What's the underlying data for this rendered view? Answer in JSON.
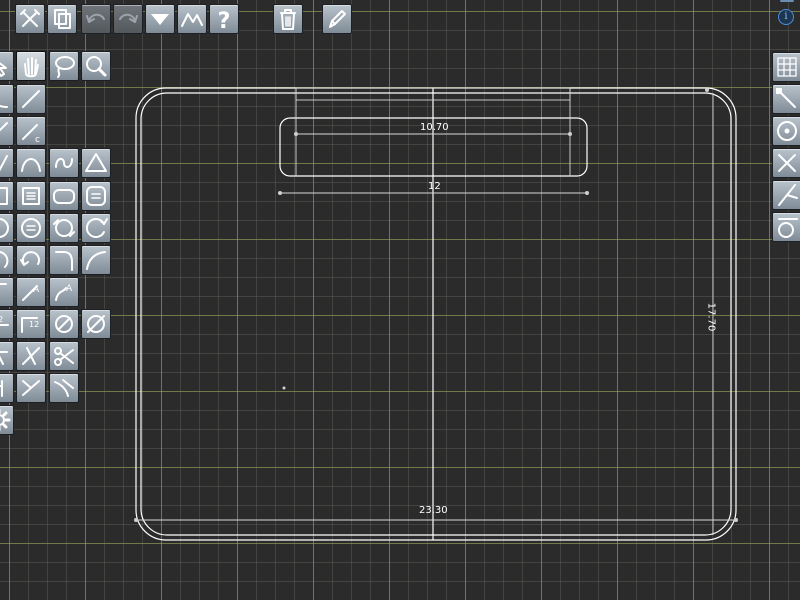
{
  "toolbar": {
    "items": [
      {
        "name": "select-tool-button",
        "icon": "crossed-tools-icon"
      },
      {
        "name": "copy-button",
        "icon": "copy-icon"
      },
      {
        "name": "undo-button",
        "icon": "undo-arrow-icon",
        "enabled": false
      },
      {
        "name": "redo-button",
        "icon": "redo-arrow-icon",
        "enabled": false
      },
      {
        "name": "menu-dropdown-button",
        "icon": "triangle-down-icon"
      },
      {
        "name": "polyline-button",
        "icon": "polyline-icon"
      },
      {
        "name": "help-button",
        "icon": "question-mark-icon",
        "label": "?"
      },
      {
        "name": "delete-button",
        "icon": "trash-icon"
      },
      {
        "name": "edit-button",
        "icon": "pencil-icon"
      }
    ]
  },
  "left_tools": {
    "rows": [
      [
        "pointer-icon",
        "pan-hand-icon",
        "lasso-icon",
        "zoom-magnifier-icon"
      ],
      [
        "curve-icon",
        "line-icon"
      ],
      [
        "line-icon",
        "line-c-icon"
      ],
      [
        "v-line-icon",
        "arc-points-icon",
        "s-curve-icon",
        "triangle-icon"
      ],
      [
        "square-icon",
        "rect-lines-icon",
        "rounded-rect-icon",
        "rounded-rect-lines-icon"
      ],
      [
        "circle-icon",
        "circle-lines-icon",
        "circle-arrows-icon",
        "circle-rotate-icon"
      ],
      [
        "arc-icon",
        "arc-undo-icon",
        "fillet-icon",
        "curve-arc-icon"
      ],
      [
        "text-icon",
        "angle-a-icon",
        "curve-a-icon"
      ],
      [
        "dim-12-icon",
        "dim-12-angle-icon",
        "circle-dim-icon",
        "circle-dim-diag-icon"
      ],
      [
        "trim-icon",
        "cross-line-icon",
        "scissors-icon"
      ],
      [
        "extend-icon",
        "mirror-icon",
        "curve-extend-icon"
      ],
      [
        "settings-gear-icon"
      ]
    ],
    "selected": "pan-hand-icon"
  },
  "snap_tools": [
    {
      "name": "snap-grid-button",
      "icon": "grid-icon"
    },
    {
      "name": "snap-endpoint-button",
      "icon": "endpoint-icon"
    },
    {
      "name": "snap-center-button",
      "icon": "center-icon"
    },
    {
      "name": "snap-intersection-button",
      "icon": "intersection-icon"
    },
    {
      "name": "snap-perpendicular-button",
      "icon": "perpendicular-icon"
    },
    {
      "name": "snap-tangent-button",
      "icon": "tangent-icon"
    }
  ],
  "info_label": "i",
  "drawing": {
    "dimensions": {
      "slot_length": "10.70",
      "slot_width": "12",
      "overall_height": "17.70",
      "overall_width": "23.30"
    }
  },
  "colors": {
    "canvas": "#2b2b2b",
    "grid_major": "#96a550",
    "grid_minor": "#5f625a",
    "geometry": "#ffffff",
    "button_face": "#9aa5af"
  }
}
